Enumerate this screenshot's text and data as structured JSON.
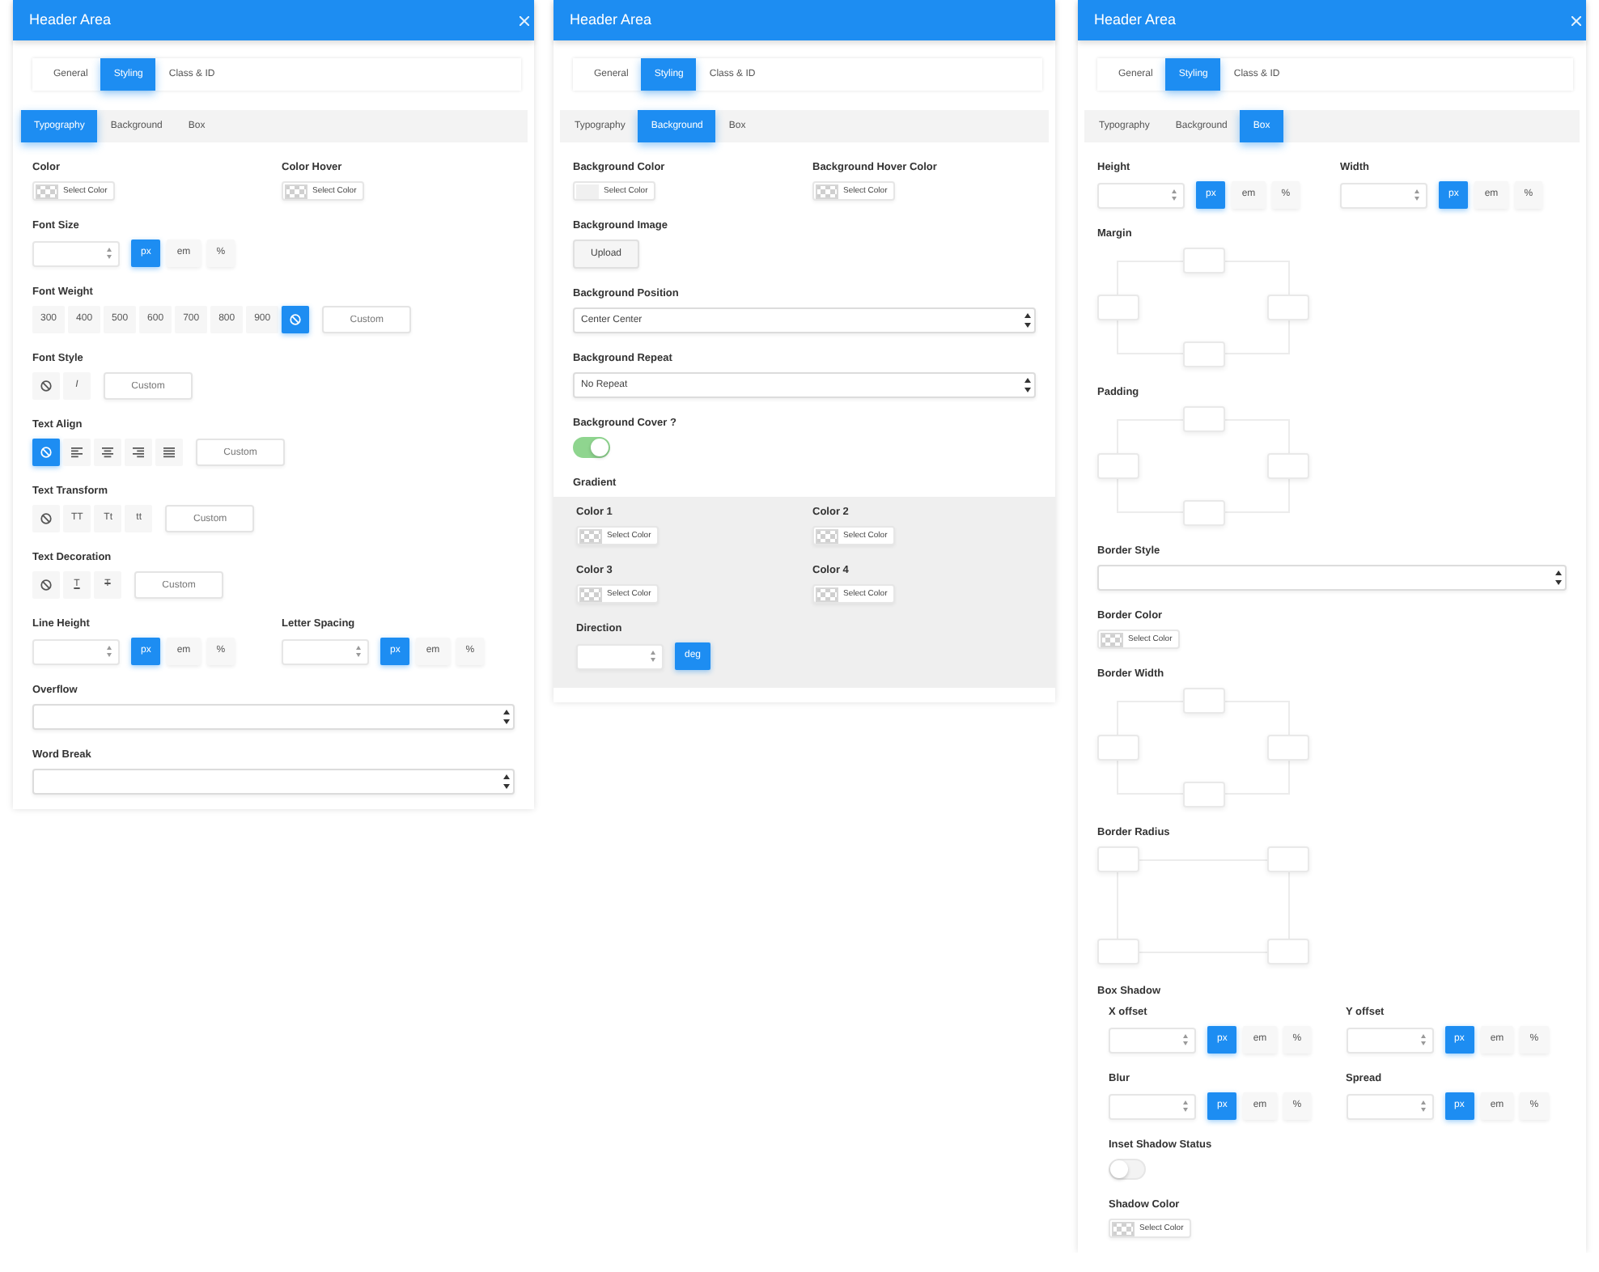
{
  "panels": [
    {
      "title": "Header Area",
      "closable": true,
      "tabs": [
        {
          "label": "General",
          "selected": false
        },
        {
          "label": "Styling",
          "selected": true
        },
        {
          "label": "Class & ID",
          "selected": false
        }
      ],
      "subtabs": [
        {
          "label": "Typography",
          "selected": true
        },
        {
          "label": "Background",
          "selected": false
        },
        {
          "label": "Box",
          "selected": false
        }
      ],
      "fields": [
        {
          "kind": "pair",
          "items": [
            {
              "kind": "color",
              "label": "Color",
              "button": "Select Color"
            },
            {
              "kind": "color",
              "label": "Color Hover",
              "button": "Select Color"
            }
          ]
        },
        {
          "kind": "number",
          "label": "Font Size",
          "units": [
            {
              "label": "px",
              "selected": true
            },
            {
              "label": "em",
              "selected": false
            },
            {
              "label": "%",
              "selected": false
            }
          ]
        },
        {
          "kind": "options",
          "label": "Font Weight",
          "options": [
            {
              "kind": "text",
              "text": "300",
              "selected": false
            },
            {
              "kind": "text",
              "text": "400",
              "selected": false
            },
            {
              "kind": "text",
              "text": "500",
              "selected": false
            },
            {
              "kind": "text",
              "text": "600",
              "selected": false
            },
            {
              "kind": "text",
              "text": "700",
              "selected": false
            },
            {
              "kind": "text",
              "text": "800",
              "selected": false
            },
            {
              "kind": "text",
              "text": "900",
              "selected": false
            },
            {
              "kind": "none",
              "selected": true
            }
          ],
          "custom": {
            "placeholder": "Custom"
          }
        },
        {
          "kind": "options",
          "label": "Font Style",
          "options": [
            {
              "kind": "none",
              "selected": false
            },
            {
              "kind": "italic",
              "text": "I",
              "selected": false
            }
          ],
          "custom": {
            "placeholder": "Custom"
          }
        },
        {
          "kind": "options",
          "label": "Text Align",
          "options": [
            {
              "kind": "none",
              "selected": true
            },
            {
              "kind": "left",
              "selected": false
            },
            {
              "kind": "center",
              "selected": false
            },
            {
              "kind": "right",
              "selected": false
            },
            {
              "kind": "justify",
              "selected": false
            }
          ],
          "custom": {
            "placeholder": "Custom"
          }
        },
        {
          "kind": "options",
          "label": "Text Transform",
          "options": [
            {
              "kind": "none",
              "selected": false
            },
            {
              "kind": "text",
              "text": "TT",
              "selected": false
            },
            {
              "kind": "text",
              "text": "Tt",
              "selected": false
            },
            {
              "kind": "text",
              "text": "tt",
              "selected": false
            }
          ],
          "custom": {
            "placeholder": "Custom"
          }
        },
        {
          "kind": "options",
          "label": "Text Decoration",
          "options": [
            {
              "kind": "none",
              "selected": false
            },
            {
              "kind": "underline",
              "text": "T",
              "selected": false
            },
            {
              "kind": "strike",
              "text": "T",
              "selected": false
            }
          ],
          "custom": {
            "placeholder": "Custom"
          }
        },
        {
          "kind": "pair",
          "items": [
            {
              "kind": "number",
              "label": "Line Height",
              "units": [
                {
                  "label": "px",
                  "selected": true
                },
                {
                  "label": "em",
                  "selected": false
                },
                {
                  "label": "%",
                  "selected": false
                }
              ]
            },
            {
              "kind": "number",
              "label": "Letter Spacing",
              "units": [
                {
                  "label": "px",
                  "selected": true
                },
                {
                  "label": "em",
                  "selected": false
                },
                {
                  "label": "%",
                  "selected": false
                }
              ]
            }
          ]
        },
        {
          "kind": "select",
          "label": "Overflow"
        },
        {
          "kind": "select",
          "label": "Word Break"
        }
      ]
    },
    {
      "title": "Header Area",
      "closable": false,
      "tabs": [
        {
          "label": "General",
          "selected": false
        },
        {
          "label": "Styling",
          "selected": true
        },
        {
          "label": "Class & ID",
          "selected": false
        }
      ],
      "subtabs": [
        {
          "label": "Typography",
          "selected": false
        },
        {
          "label": "Background",
          "selected": true
        },
        {
          "label": "Box",
          "selected": false
        }
      ],
      "fields": [
        {
          "kind": "pair",
          "items": [
            {
              "kind": "color",
              "label": "Background Color",
              "button": "Select Color",
              "color": "#f0f0f0"
            },
            {
              "kind": "color",
              "label": "Background Hover Color",
              "button": "Select Color"
            }
          ]
        },
        {
          "kind": "upload",
          "label": "Background Image",
          "button": "Upload"
        },
        {
          "kind": "select",
          "label": "Background Position",
          "value": "Center Center"
        },
        {
          "kind": "select",
          "label": "Background Repeat",
          "value": "No Repeat"
        },
        {
          "kind": "toggle",
          "label": "Background Cover ?",
          "on": true
        },
        {
          "kind": "panel",
          "label": "Gradient",
          "items": [
            {
              "kind": "pair",
              "items": [
                {
                  "kind": "color",
                  "label": "Color 1",
                  "button": "Select Color"
                },
                {
                  "kind": "color",
                  "label": "Color 2",
                  "button": "Select Color"
                }
              ]
            },
            {
              "kind": "pair",
              "items": [
                {
                  "kind": "color",
                  "label": "Color 3",
                  "button": "Select Color"
                },
                {
                  "kind": "color",
                  "label": "Color 4",
                  "button": "Select Color"
                }
              ]
            },
            {
              "kind": "number",
              "label": "Direction",
              "units": [
                {
                  "label": "deg",
                  "selected": true
                }
              ]
            }
          ]
        }
      ]
    },
    {
      "title": "Header Area",
      "closable": true,
      "tabs": [
        {
          "label": "General",
          "selected": false
        },
        {
          "label": "Styling",
          "selected": true
        },
        {
          "label": "Class & ID",
          "selected": false
        }
      ],
      "subtabs": [
        {
          "label": "Typography",
          "selected": false
        },
        {
          "label": "Background",
          "selected": false
        },
        {
          "label": "Box",
          "selected": true
        }
      ],
      "fields": [
        {
          "kind": "pair",
          "items": [
            {
              "kind": "number",
              "label": "Height",
              "units": [
                {
                  "label": "px",
                  "selected": true
                },
                {
                  "label": "em",
                  "selected": false
                },
                {
                  "label": "%",
                  "selected": false
                }
              ]
            },
            {
              "kind": "number",
              "label": "Width",
              "units": [
                {
                  "label": "px",
                  "selected": true
                },
                {
                  "label": "em",
                  "selected": false
                },
                {
                  "label": "%",
                  "selected": false
                }
              ]
            }
          ]
        },
        {
          "kind": "sides",
          "label": "Margin"
        },
        {
          "kind": "sides",
          "label": "Padding"
        },
        {
          "kind": "select",
          "label": "Border Style"
        },
        {
          "kind": "color",
          "label": "Border Color",
          "button": "Select Color"
        },
        {
          "kind": "sides",
          "label": "Border Width"
        },
        {
          "kind": "corners",
          "label": "Border Radius"
        },
        {
          "kind": "group",
          "label": "Box Shadow",
          "items": [
            {
              "kind": "pair",
              "items": [
                {
                  "kind": "number",
                  "label": "X offset",
                  "units": [
                    {
                      "label": "px",
                      "selected": true
                    },
                    {
                      "label": "em",
                      "selected": false
                    },
                    {
                      "label": "%",
                      "selected": false
                    }
                  ]
                },
                {
                  "kind": "number",
                  "label": "Y offset",
                  "units": [
                    {
                      "label": "px",
                      "selected": true
                    },
                    {
                      "label": "em",
                      "selected": false
                    },
                    {
                      "label": "%",
                      "selected": false
                    }
                  ]
                }
              ]
            },
            {
              "kind": "pair",
              "items": [
                {
                  "kind": "number",
                  "label": "Blur",
                  "units": [
                    {
                      "label": "px",
                      "selected": true
                    },
                    {
                      "label": "em",
                      "selected": false
                    },
                    {
                      "label": "%",
                      "selected": false
                    }
                  ]
                },
                {
                  "kind": "number",
                  "label": "Spread",
                  "units": [
                    {
                      "label": "px",
                      "selected": true
                    },
                    {
                      "label": "em",
                      "selected": false
                    },
                    {
                      "label": "%",
                      "selected": false
                    }
                  ]
                }
              ]
            },
            {
              "kind": "toggle",
              "label": "Inset Shadow Status",
              "on": false
            },
            {
              "kind": "color",
              "label": "Shadow Color",
              "button": "Select Color"
            }
          ]
        }
      ]
    }
  ]
}
